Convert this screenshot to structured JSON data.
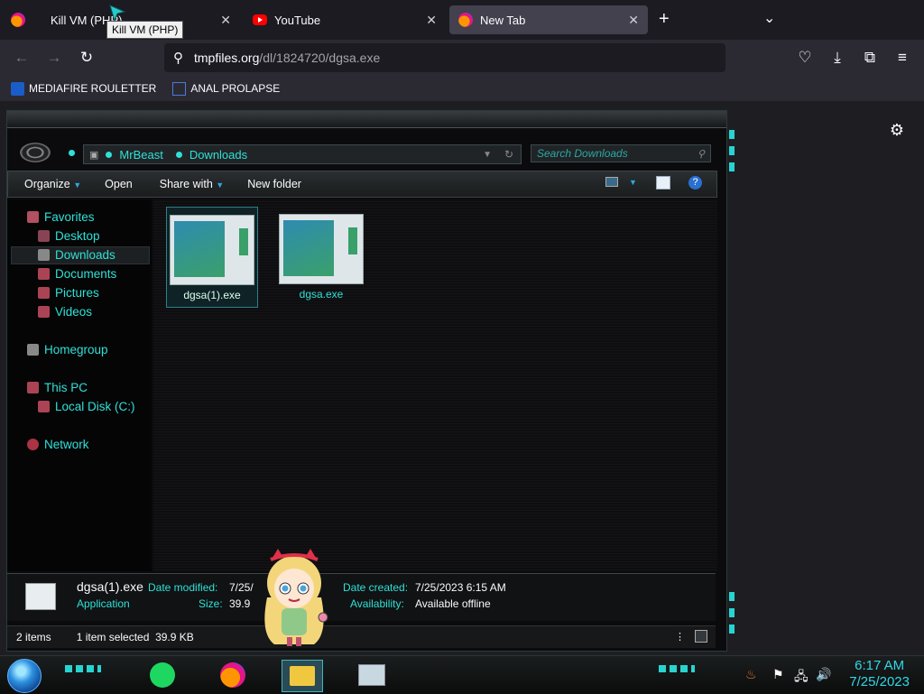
{
  "browser": {
    "tabs": [
      {
        "title": "Kill VM (PHP)",
        "active": false
      },
      {
        "title": "YouTube",
        "active": false
      },
      {
        "title": "New Tab",
        "active": true
      }
    ],
    "tooltip": "Kill VM (PHP)",
    "url_host": "tmpfiles.org",
    "url_path": "/dl/1824720/dgsa.exe",
    "bookmarks": [
      {
        "label": "MEDIAFIRE ROULETTER"
      },
      {
        "label": "ANAL PROLAPSE"
      }
    ],
    "new_tab_symbol": "+",
    "close_symbol": "✕"
  },
  "explorer": {
    "breadcrumb": [
      "MrBeast",
      "Downloads"
    ],
    "search_placeholder": "Search Downloads",
    "toolbar": {
      "organize": "Organize",
      "open": "Open",
      "share_with": "Share with",
      "new_folder": "New folder"
    },
    "nav": {
      "favorites": "Favorites",
      "desktop": "Desktop",
      "downloads": "Downloads",
      "documents": "Documents",
      "pictures": "Pictures",
      "videos": "Videos",
      "homegroup": "Homegroup",
      "this_pc": "This PC",
      "local_disk": "Local Disk (C:)",
      "network": "Network"
    },
    "files": [
      {
        "name": "dgsa(1).exe",
        "selected": true
      },
      {
        "name": "dgsa.exe",
        "selected": false
      }
    ],
    "details": {
      "name": "dgsa(1).exe",
      "type": "Application",
      "date_modified_label": "Date modified:",
      "date_modified_value": "7/25/",
      "size_label": "Size:",
      "size_value": "39.9",
      "date_created_label": "Date created:",
      "date_created_value": "7/25/2023 6:15 AM",
      "availability_label": "Availability:",
      "availability_value": "Available offline"
    },
    "status": {
      "items": "2 items",
      "selected": "1 item selected  39.9 KB"
    }
  },
  "taskbar": {
    "time": "6:17 AM",
    "date": "7/25/2023"
  },
  "colors": {
    "accent": "#2fe0d6",
    "browser_bg": "#1c1b22",
    "toolbar_bg": "#2b2a33"
  }
}
